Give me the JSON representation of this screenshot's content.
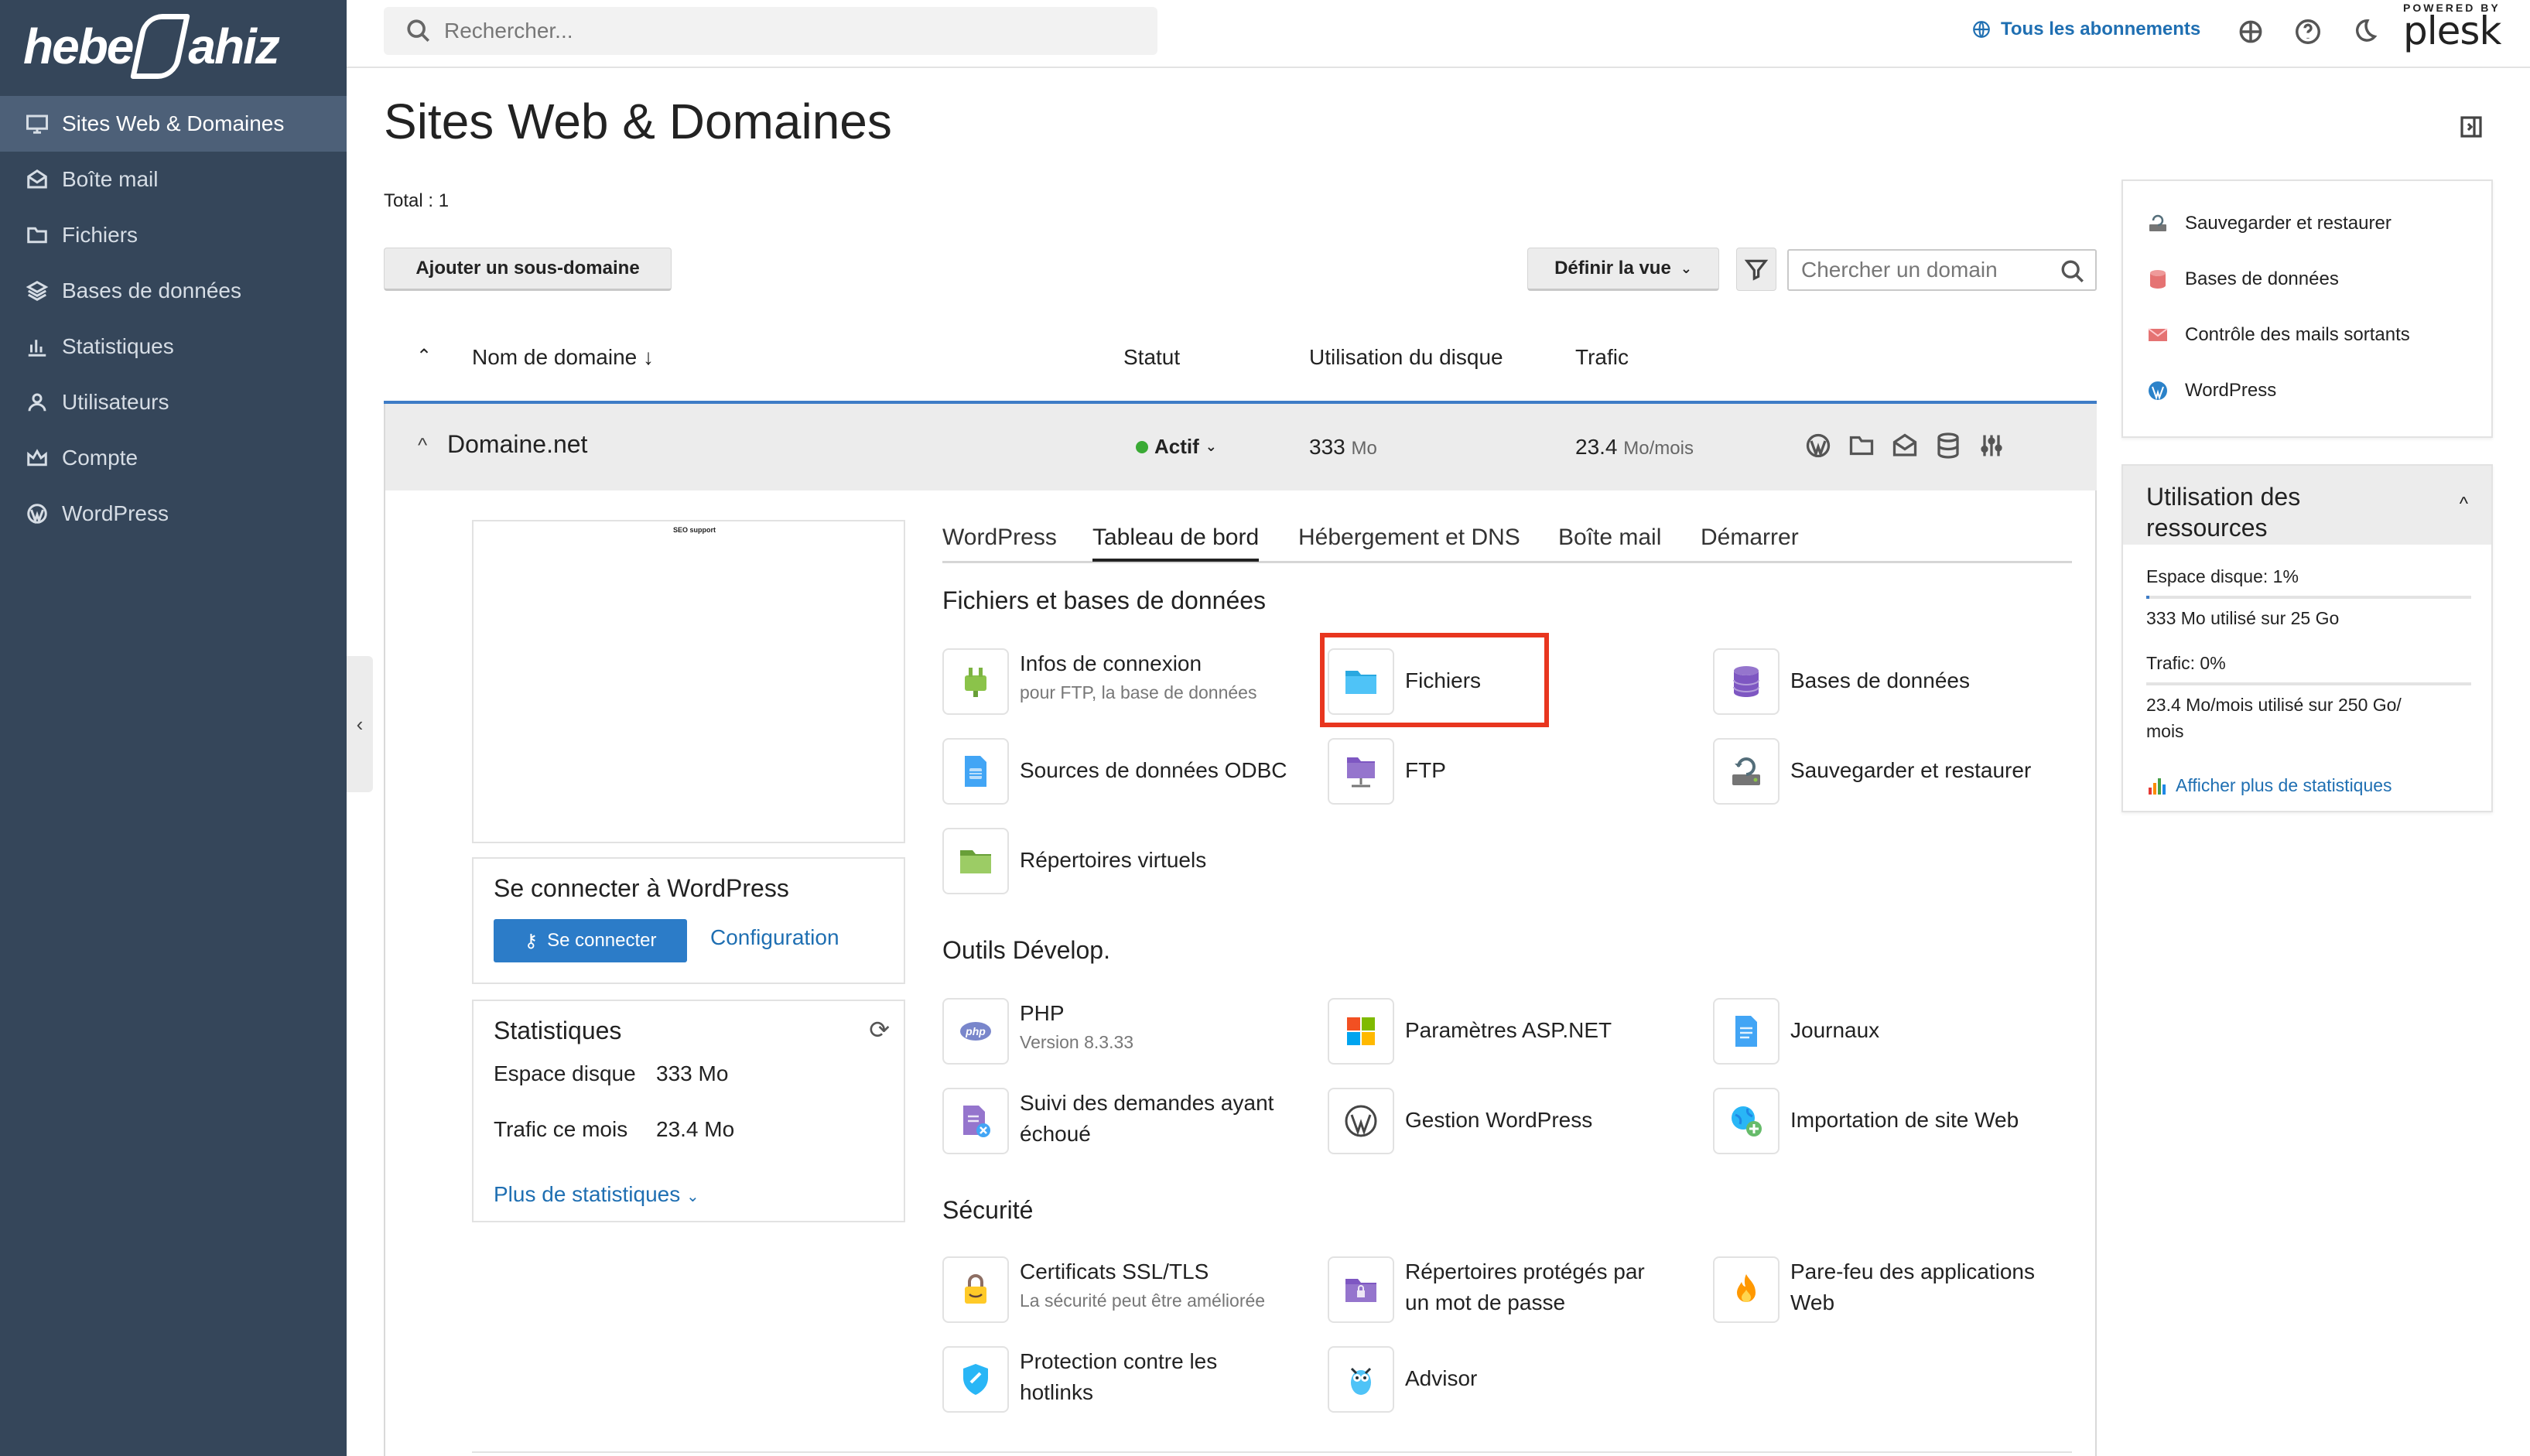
{
  "brand": {
    "logo_text_left": "hebe",
    "logo_text_right": "ahiz",
    "powered_by": "POWERED BY",
    "plesk": "plesk"
  },
  "sidebar": {
    "items": [
      {
        "label": "Sites Web & Domaines",
        "icon": "monitor-icon",
        "active": true
      },
      {
        "label": "Boîte mail",
        "icon": "mail-icon"
      },
      {
        "label": "Fichiers",
        "icon": "folder-icon"
      },
      {
        "label": "Bases de données",
        "icon": "layers-icon"
      },
      {
        "label": "Statistiques",
        "icon": "bar-chart-icon"
      },
      {
        "label": "Utilisateurs",
        "icon": "user-icon"
      },
      {
        "label": "Compte",
        "icon": "crown-icon"
      },
      {
        "label": "WordPress",
        "icon": "wordpress-icon"
      }
    ]
  },
  "topbar": {
    "search_placeholder": "Rechercher...",
    "subscriptions": "Tous les abonnements"
  },
  "page": {
    "title": "Sites Web & Domaines",
    "total": "Total : 1"
  },
  "toolbar": {
    "add_subdomain": "Ajouter un sous-domaine",
    "define_view": "Définir la vue",
    "domain_search_placeholder": "Chercher un domain"
  },
  "table": {
    "headers": {
      "name": "Nom de domaine ↓",
      "status": "Statut",
      "disk": "Utilisation du disque",
      "traffic": "Trafic"
    },
    "row": {
      "domain": "Domaine.net",
      "status": "Actif",
      "disk_value": "333",
      "disk_unit": "Mo",
      "traffic_value": "23.4",
      "traffic_unit": "Mo/mois"
    }
  },
  "preview": {
    "caption": "SEO support"
  },
  "wp_card": {
    "title": "Se connecter à WordPress",
    "login": "Se connecter",
    "config": "Configuration"
  },
  "stats_card": {
    "title": "Statistiques",
    "disk_label": "Espace disque",
    "disk_value": "333 Mo",
    "traffic_label": "Trafic ce mois",
    "traffic_value": "23.4 Mo",
    "more": "Plus de statistiques"
  },
  "tabs": [
    "WordPress",
    "Tableau de bord",
    "Hébergement et DNS",
    "Boîte mail",
    "Démarrer"
  ],
  "active_tab": "Tableau de bord",
  "sections": {
    "files_db": "Fichiers et bases de données",
    "dev": "Outils Dévelop.",
    "security": "Sécurité"
  },
  "tools": {
    "infos": {
      "title": "Infos de connexion",
      "sub": "pour FTP, la base de données"
    },
    "fichiers": {
      "title": "Fichiers"
    },
    "bases": {
      "title": "Bases de données"
    },
    "odbc": {
      "title": "Sources de données ODBC"
    },
    "ftp": {
      "title": "FTP"
    },
    "backup": {
      "title": "Sauvegarder et restaurer"
    },
    "virt": {
      "title": "Répertoires virtuels"
    },
    "php": {
      "title": "PHP",
      "sub": "Version 8.3.33"
    },
    "asp": {
      "title": "Paramètres ASP.NET"
    },
    "logs": {
      "title": "Journaux"
    },
    "failed_l1": {
      "title": "Suivi des demandes ayant"
    },
    "failed_l2": {
      "title": "échoué"
    },
    "wpmgmt": {
      "title": "Gestion WordPress"
    },
    "import": {
      "title": "Importation de site Web"
    },
    "ssl": {
      "title": "Certificats SSL/TLS",
      "sub": "La sécurité peut être améliorée"
    },
    "protdir_l1": {
      "title": "Répertoires protégés par"
    },
    "protdir_l2": {
      "title": "un mot de passe"
    },
    "waf_l1": {
      "title": "Pare-feu des applications"
    },
    "waf_l2": {
      "title": "Web"
    },
    "hotlink_l1": {
      "title": "Protection contre les"
    },
    "hotlink_l2": {
      "title": "hotlinks"
    },
    "advisor": {
      "title": "Advisor"
    }
  },
  "right_links": [
    "Sauvegarder et restaurer",
    "Bases de données",
    "Contrôle des mails sortants",
    "WordPress"
  ],
  "resources": {
    "title_l1": "Utilisation des",
    "title_l2": "ressources",
    "disk_label": "Espace disque: 1%",
    "disk_fraction": 0.01,
    "disk_detail": "333 Mo utilisé sur 25 Go",
    "traffic_label": "Trafic: 0%",
    "traffic_fraction": 0.0,
    "traffic_detail_l1": "23.4 Mo/mois utilisé sur 250 Go/",
    "traffic_detail_l2": "mois",
    "more": "Afficher plus de statistiques"
  },
  "colors": {
    "sidebar_bg": "#35465a",
    "accent": "#1f6fb2",
    "highlight": "#e8361f",
    "active_green": "#3aaa35"
  }
}
